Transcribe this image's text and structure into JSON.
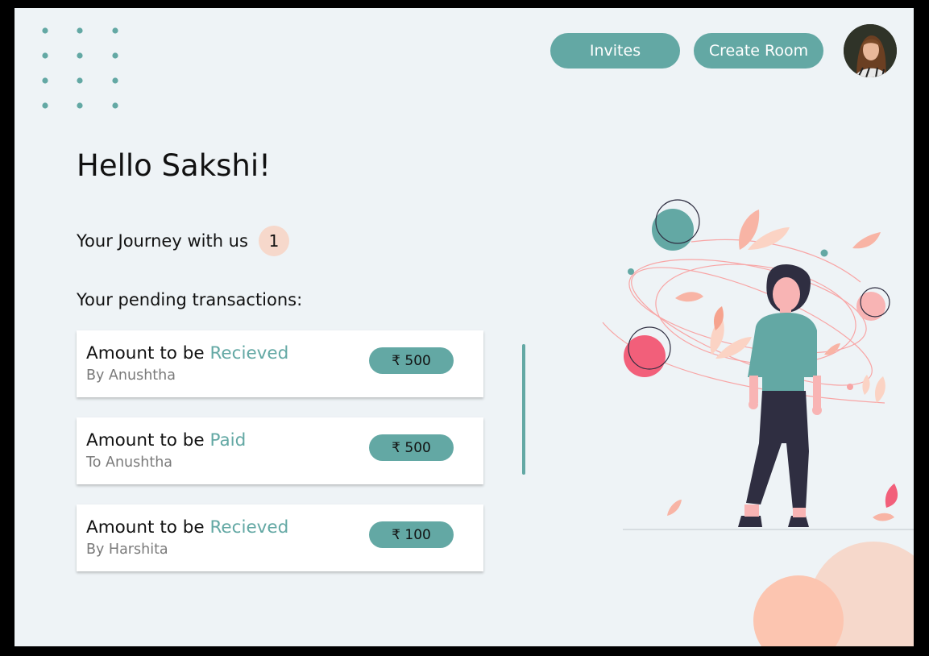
{
  "header": {
    "invites_label": "Invites",
    "create_room_label": "Create Room"
  },
  "greeting": "Hello Sakshi!",
  "journey": {
    "label": "Your Journey with us",
    "count": "1"
  },
  "pending": {
    "title": "Your pending transactions:",
    "items": [
      {
        "prefix": "Amount to be ",
        "status": "Recieved",
        "counterparty": "By Anushtha",
        "amount": "₹ 500"
      },
      {
        "prefix": "Amount to be ",
        "status": "Paid",
        "counterparty": "To Anushtha",
        "amount": "₹ 500"
      },
      {
        "prefix": "Amount to be ",
        "status": "Recieved",
        "counterparty": "By Harshita",
        "amount": "₹ 100"
      }
    ]
  },
  "colors": {
    "accent": "#63a8a4",
    "background": "#eef3f6",
    "peach": "#f6d8cb",
    "pink": "#f25f7a"
  },
  "icons": {
    "decor": "dot-grid-icon",
    "profile": "user-avatar",
    "illustration": "woman-standing-illustration"
  }
}
